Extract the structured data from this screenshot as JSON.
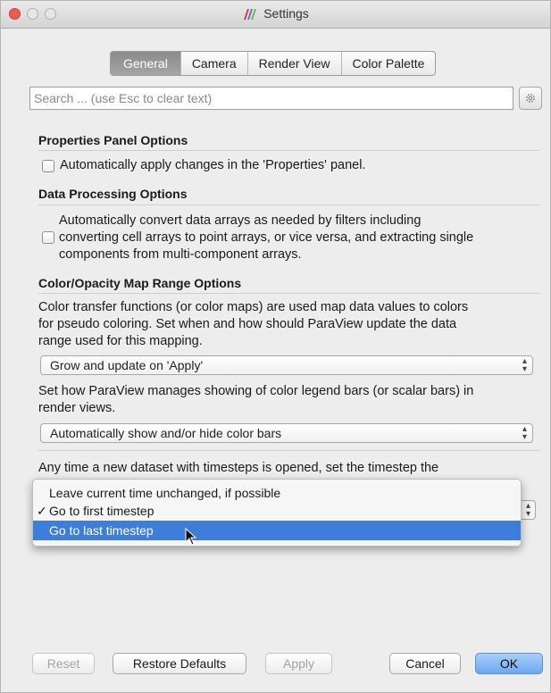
{
  "window": {
    "title": "Settings"
  },
  "tabs": [
    {
      "label": "General",
      "active": true
    },
    {
      "label": "Camera",
      "active": false
    },
    {
      "label": "Render View",
      "active": false
    },
    {
      "label": "Color Palette",
      "active": false
    }
  ],
  "search": {
    "placeholder": "Search ... (use Esc to clear text)",
    "value": ""
  },
  "sections": {
    "properties_panel": {
      "title": "Properties Panel Options",
      "checkbox_label": "Automatically apply changes in the 'Properties' panel.",
      "checked": false
    },
    "data_processing": {
      "title": "Data Processing Options",
      "checkbox_lines": [
        "Automatically convert data arrays as needed by filters including",
        "converting cell arrays to point arrays, or vice versa, and extracting single",
        "components from multi-component arrays."
      ],
      "checked": false
    },
    "color_opacity": {
      "title": "Color/Opacity Map Range Options",
      "description_lines": [
        "Color transfer functions (or color maps) are used map data values to colors",
        "for pseudo coloring. Set when and how should ParaView update the data",
        "range used for this mapping."
      ],
      "range_select": "Grow and update on 'Apply'",
      "legend_description_lines": [
        "Set how ParaView manages showing of color legend bars (or scalar bars) in",
        "render views."
      ],
      "legend_select": "Automatically show and/or hide color bars",
      "timestep_description": "Any time a new dataset with timesteps is opened, set the timestep the"
    }
  },
  "timestep_dropdown": {
    "options": [
      {
        "label": "Leave current time unchanged, if possible",
        "checked": false,
        "highlighted": false
      },
      {
        "label": "Go to first timestep",
        "checked": true,
        "highlighted": false
      },
      {
        "label": "Go to last timestep",
        "checked": false,
        "highlighted": true
      }
    ],
    "check_glyph": "✓"
  },
  "buttons": {
    "reset": "Reset",
    "restore_defaults": "Restore Defaults",
    "apply": "Apply",
    "cancel": "Cancel",
    "ok": "OK"
  },
  "colors": {
    "highlight": "#3d7edb",
    "close_button": "#ef5a55",
    "default_button": "#6aa9ef"
  },
  "icons": {
    "app": "paraview-logo-icon",
    "gear": "gear-icon",
    "stepper": "up-down-arrows-icon",
    "pointer": "mouse-pointer-icon"
  }
}
